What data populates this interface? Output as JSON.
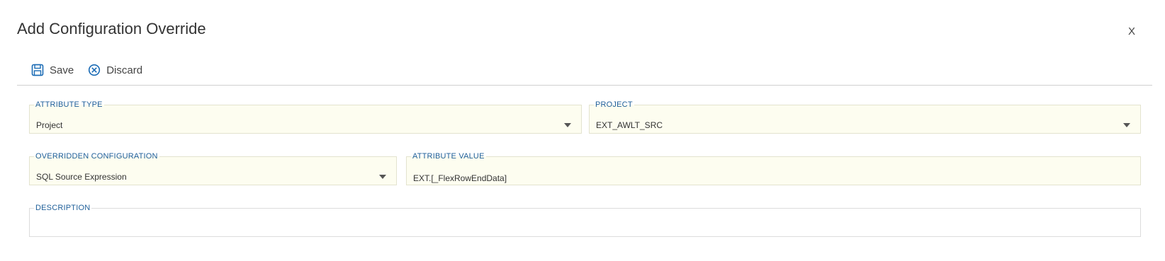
{
  "dialog": {
    "title": "Add Configuration Override",
    "close_label": "X"
  },
  "toolbar": {
    "save_label": "Save",
    "discard_label": "Discard"
  },
  "form": {
    "attribute_type": {
      "label": "ATTRIBUTE TYPE",
      "value": "Project"
    },
    "project": {
      "label": "PROJECT",
      "value": "EXT_AWLT_SRC"
    },
    "overridden_configuration": {
      "label": "OVERRIDDEN CONFIGURATION",
      "value": "SQL Source Expression"
    },
    "attribute_value": {
      "label": "ATTRIBUTE VALUE",
      "value": "EXT.[_FlexRowEndData]"
    },
    "description": {
      "label": "DESCRIPTION",
      "value": ""
    }
  },
  "colors": {
    "field_bg": "#fdfdf0",
    "label_blue": "#1f5f99",
    "icon_blue": "#1a6bb5"
  }
}
